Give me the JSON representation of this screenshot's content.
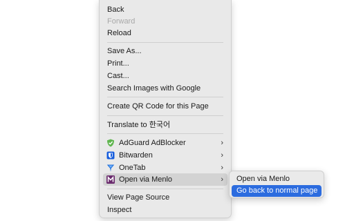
{
  "context_menu": {
    "items": [
      {
        "label": "Back"
      },
      {
        "label": "Forward",
        "disabled": true
      },
      {
        "label": "Reload"
      },
      {
        "label": "Save As..."
      },
      {
        "label": "Print..."
      },
      {
        "label": "Cast..."
      },
      {
        "label": "Search Images with Google"
      },
      {
        "label": "Create QR Code for this Page"
      },
      {
        "label": "Translate to 한국어"
      }
    ],
    "extensions": [
      {
        "label": "AdGuard AdBlocker",
        "icon": "adguard-shield-icon",
        "color": "#5fb54e",
        "chevron": "›"
      },
      {
        "label": "Bitwarden",
        "icon": "bitwarden-shield-icon",
        "color": "#175ddc",
        "chevron": "›"
      },
      {
        "label": "OneTab",
        "icon": "onetab-funnel-icon",
        "color": "#1e6fd9",
        "chevron": "›"
      },
      {
        "label": "Open via Menlo",
        "icon": "menlo-m-icon",
        "color": "#6b2c6e",
        "chevron": "›",
        "highlighted": true
      }
    ],
    "bottom": [
      {
        "label": "View Page Source"
      },
      {
        "label": "Inspect"
      }
    ]
  },
  "submenu": {
    "items": [
      {
        "label": "Open via Menlo"
      },
      {
        "label": "Go back to normal page",
        "selected": true
      }
    ],
    "selection_color": "#2c6cdf"
  }
}
